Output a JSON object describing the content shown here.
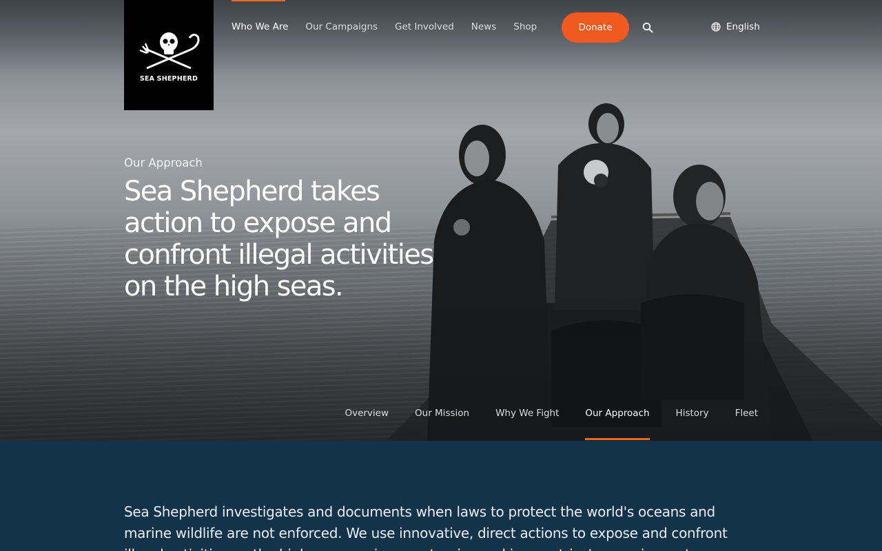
{
  "brand": {
    "logo_text": "SEA SHEPHERD"
  },
  "nav": {
    "items": [
      {
        "label": "Who We Are",
        "active": true
      },
      {
        "label": "Our Campaigns"
      },
      {
        "label": "Get Involved"
      },
      {
        "label": "News"
      },
      {
        "label": "Shop"
      }
    ],
    "donate_label": "Donate",
    "search_icon": "search-icon",
    "language_label": "English",
    "language_icon": "globe-icon"
  },
  "hero": {
    "eyebrow": "Our Approach",
    "headline": "Sea Shepherd takes action to expose and confront illegal activities on the high seas."
  },
  "subnav": {
    "items": [
      {
        "label": "Overview"
      },
      {
        "label": "Our Mission"
      },
      {
        "label": "Why We Fight"
      },
      {
        "label": "Our Approach",
        "active": true
      },
      {
        "label": "History"
      },
      {
        "label": "Fleet"
      }
    ]
  },
  "content": {
    "intro": "Sea Shepherd investigates and documents when laws to protect the world's oceans and marine wildlife are not enforced. We use innovative, direct actions to expose and confront illegal activities on the high seas marine sanctuaries and in countries' sovereign waters."
  },
  "colors": {
    "accent": "#f26722",
    "donate": "#f15a1f",
    "content_bg": "#13334a"
  }
}
